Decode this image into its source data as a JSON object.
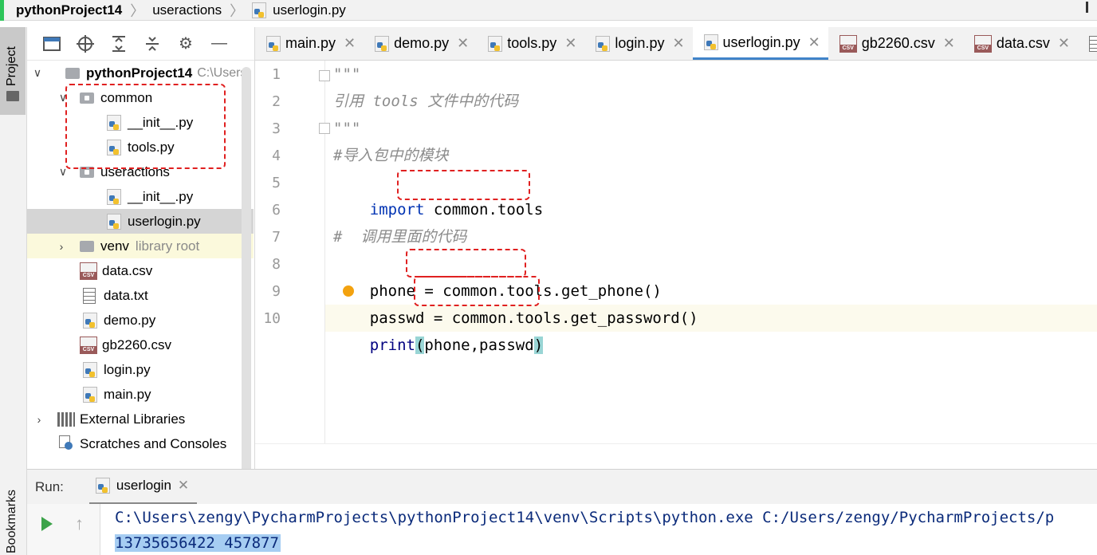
{
  "breadcrumb": {
    "project": "pythonProject14",
    "folder": "useractions",
    "file": "userlogin.py"
  },
  "toolstrip": {
    "project_label": "Project",
    "bookmarks_label": "Bookmarks"
  },
  "project_tree": {
    "root": {
      "name": "pythonProject14",
      "path_hint": "C:\\Users"
    },
    "items": [
      {
        "label": "common"
      },
      {
        "label": "__init__.py"
      },
      {
        "label": "tools.py"
      },
      {
        "label": "useractions"
      },
      {
        "label": "__init__.py"
      },
      {
        "label": "userlogin.py"
      },
      {
        "label": "venv",
        "hint": "library root"
      },
      {
        "label": "data.csv"
      },
      {
        "label": "data.txt"
      },
      {
        "label": "demo.py"
      },
      {
        "label": "gb2260.csv"
      },
      {
        "label": "login.py"
      },
      {
        "label": "main.py"
      },
      {
        "label": "External Libraries"
      },
      {
        "label": "Scratches and Consoles"
      }
    ]
  },
  "tabs": [
    {
      "label": "main.py"
    },
    {
      "label": "demo.py"
    },
    {
      "label": "tools.py"
    },
    {
      "label": "login.py"
    },
    {
      "label": "userlogin.py",
      "active": true
    },
    {
      "label": "gb2260.csv"
    },
    {
      "label": "data.csv"
    }
  ],
  "editor": {
    "line_numbers": [
      "1",
      "2",
      "3",
      "4",
      "5",
      "6",
      "7",
      "8",
      "9",
      "10"
    ],
    "lines": {
      "l1": "\"\"\"",
      "l2": "引用 tools 文件中的代码",
      "l3": "\"\"\"",
      "l4": "#导入包中的模块",
      "l5_kw": "import",
      "l5_mod": "common.tools",
      "l7": "#  调用里面的代码",
      "l8_a": "phone = ",
      "l8_b": "common.tools",
      "l8_c": ".get_phone()",
      "l9_a": "passwd = ",
      "l9_b": "common.tools",
      "l9_c": ".get_password()",
      "l10_fn": "print",
      "l10_open": "(",
      "l10_args": "phone,passwd",
      "l10_close": ")"
    }
  },
  "run": {
    "label": "Run:",
    "tab": "userlogin",
    "console_line1": "C:\\Users\\zengy\\PycharmProjects\\pythonProject14\\venv\\Scripts\\python.exe C:/Users/zengy/PycharmProjects/p",
    "console_line2": "13735656422 457877"
  },
  "colors": {
    "accent_green": "#2ec55a",
    "tab_active_underline": "#4083c9",
    "annotation_red": "#e02020",
    "keyword_blue": "#0033b3",
    "comment_gray": "#8c8c8c"
  }
}
